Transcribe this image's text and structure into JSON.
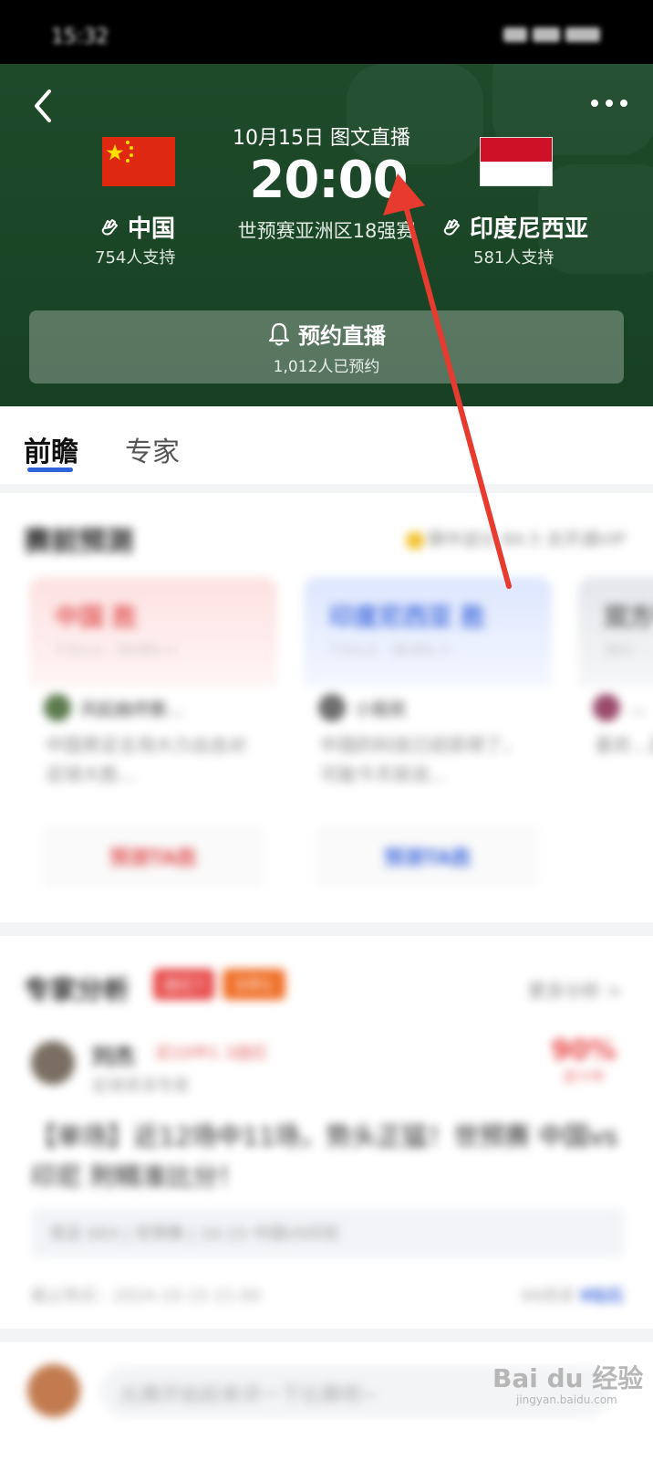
{
  "status_bar": {
    "time": "15:32"
  },
  "match": {
    "date_label": "10月15日  图文直播",
    "time": "20:00",
    "round": "世预赛亚洲区18强赛",
    "home": {
      "name": "中国",
      "support": "754人支持"
    },
    "away": {
      "name": "印度尼西亚",
      "support": "581人支持"
    },
    "reserve": {
      "label": "预约直播",
      "count": "1,012人已预约"
    }
  },
  "tabs": {
    "preview": "前瞻",
    "expert": "专家"
  },
  "prediction": {
    "title": "赛前预测",
    "more": "猜中送分 84.5 去开通VIP",
    "cards": [
      {
        "title": "中国 胜",
        "sub": "7.5人人 · 54.8% >",
        "author": "风起曲终散...",
        "text": "中国男足主场大力出击对足球大胜...",
        "button": "预测TA胜"
      },
      {
        "title": "印度尼西亚 胜",
        "sub": "7.5人人 · 36.8% >",
        "author": "小股民",
        "text": "中国的科技已经获得了，可能今天就说...",
        "button": "预测TA胜"
      },
      {
        "title": "双方平",
        "sub": "28人 · ...",
        "author": "...",
        "text": "喜欢...足球...",
        "button": ""
      }
    ]
  },
  "expert": {
    "title": "专家分析",
    "badge_red": "连红7",
    "badge_orange": "5中1",
    "more": "更多分析 >",
    "name": "刘杰",
    "tags": "近10中1  3连红",
    "desc": "足球资深专家",
    "rate": "90%",
    "rate_label": "近十中",
    "headline": "【单场】近12场中11场，势头正猛！世预赛 中国vs印尼 附精准比分！",
    "match_line": "竞足  003 | 世预赛 | 10-15 中国VS印尼",
    "footer_left": "截止购买：2024-10-15 21:00",
    "footer_right": "99阅读",
    "price": "9钻石"
  },
  "comment": {
    "placeholder": "比赛开始前来评一下比赛吧~"
  },
  "watermark": {
    "main": "Bai du 经验",
    "sub": "jingyan.baidu.com"
  },
  "colors": {
    "header_green": "#1e4a2a",
    "accent_blue": "#2f63d9",
    "arrow_red": "#e63b2e"
  }
}
